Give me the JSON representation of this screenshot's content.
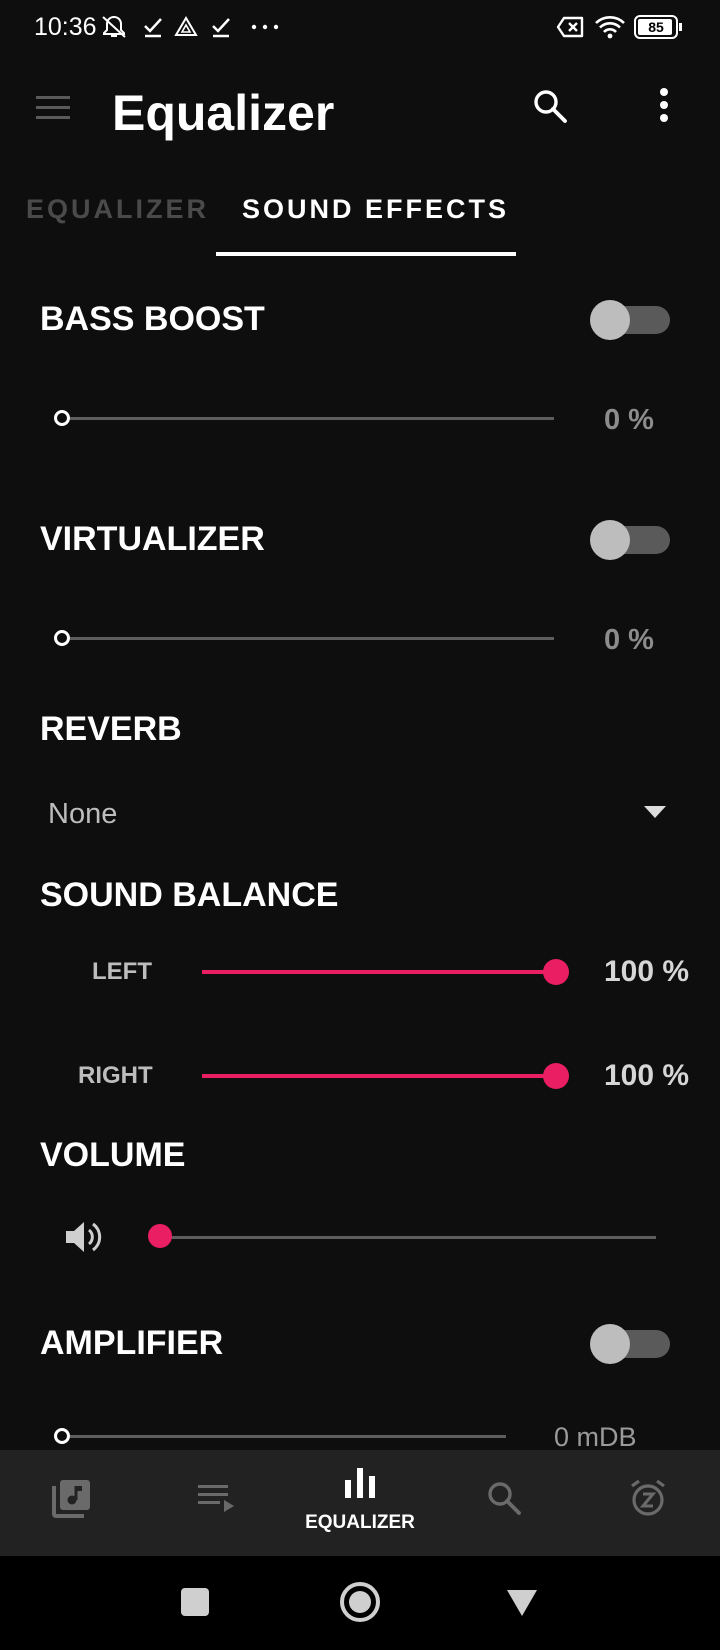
{
  "status_bar": {
    "time": "10:36",
    "icons": [
      "notifications-off-icon",
      "check-icon",
      "drive-icon",
      "check-icon",
      "more-dots-icon",
      "no-sim-icon",
      "wifi-icon",
      "battery-icon"
    ],
    "battery": "85"
  },
  "app_bar": {
    "title": "Equalizer",
    "icons": [
      "menu-icon",
      "search-icon",
      "more-vert-icon"
    ]
  },
  "tabs": [
    {
      "label": "EQUALIZER",
      "active": false
    },
    {
      "label": "SOUND EFFECTS",
      "active": true
    }
  ],
  "bass_boost": {
    "title": "BASS BOOST",
    "enabled": false,
    "value": "0 %",
    "level": 0
  },
  "virtualizer": {
    "title": "VIRTUALIZER",
    "enabled": false,
    "value": "0 %",
    "level": 0
  },
  "reverb": {
    "title": "REVERB",
    "selected": "None"
  },
  "sound_balance": {
    "title": "SOUND BALANCE",
    "left": {
      "label": "LEFT",
      "value": "100 %",
      "level": 100
    },
    "right": {
      "label": "RIGHT",
      "value": "100 %",
      "level": 100
    }
  },
  "volume": {
    "title": "VOLUME",
    "level": 0
  },
  "amplifier": {
    "title": "AMPLIFIER",
    "enabled": false,
    "value": "0 mDB",
    "level": 0
  },
  "bottom_nav": {
    "items": [
      {
        "icon": "music-library-icon",
        "label": ""
      },
      {
        "icon": "queue-icon",
        "label": ""
      },
      {
        "icon": "equalizer-icon",
        "label": "EQUALIZER",
        "active": true
      },
      {
        "icon": "search-icon",
        "label": ""
      },
      {
        "icon": "sleep-timer-icon",
        "label": ""
      }
    ]
  },
  "colors": {
    "accent": "#e91e63",
    "background": "#0e0e0e",
    "bottom_nav_bg": "#222222"
  }
}
